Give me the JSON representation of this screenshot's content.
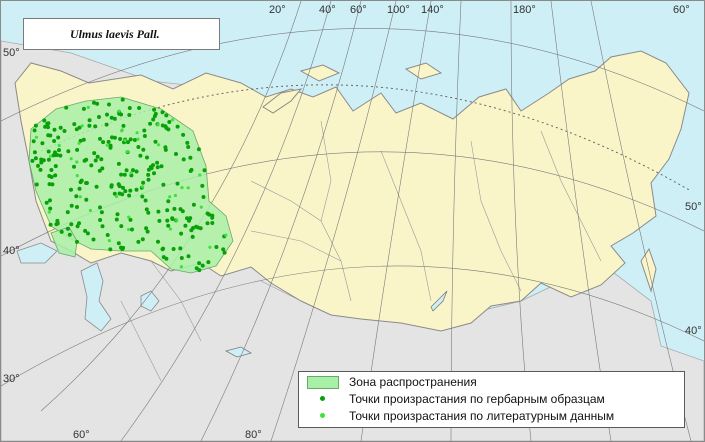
{
  "title": "Ulmus laevis Pall.",
  "legend": {
    "zone": "Зона распространения",
    "herbarium": "Точки произрастания по гербарным образцам",
    "literature": "Точки произрастания по литературным данным"
  },
  "top_labels": [
    "20°",
    "40°",
    "60°",
    "100°",
    "140°",
    "180°",
    "60°"
  ],
  "bottom_labels": [
    "60°",
    "80°"
  ],
  "left_labels": [
    "50°",
    "40°",
    "30°"
  ],
  "right_labels": [
    "50°",
    "40°"
  ],
  "colors": {
    "sea": "#cfeff6",
    "land": "#faf5c8",
    "outer_land": "#e4e4e4",
    "zone": "#a8f0a8",
    "herbarium_dot": "#0aa00a",
    "literature_dot": "#3fe03f"
  }
}
